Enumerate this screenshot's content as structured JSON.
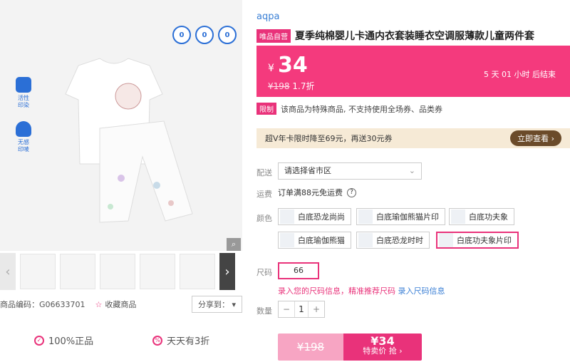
{
  "gallery": {
    "badges": [
      "0",
      "0",
      "0"
    ],
    "features": [
      "活性\n印染",
      "无感\n印唛"
    ],
    "zoom_icon": "magnifier-icon",
    "thumbs_count": 5
  },
  "meta": {
    "code_label": "商品编码：",
    "code_value": "G06633701",
    "fav_label": "收藏商品",
    "share_label": "分享到："
  },
  "guarantee": {
    "a": "100%正品",
    "b": "天天有3折"
  },
  "product": {
    "brand": "aqpa",
    "self_tag": "唯品自营",
    "title": "夏季纯棉婴儿卡通内衣套装睡衣空调服薄款儿童两件套",
    "currency": "¥",
    "price": "34",
    "orig_price": "¥198",
    "discount": "1.7折",
    "countdown": "5 天 01 小时 后结束"
  },
  "notice": {
    "tag": "限制",
    "text": "该商品为特殊商品, 不支持使用全场券、品类券"
  },
  "vip": {
    "text": "超V年卡限时降至69元，再送30元券",
    "btn": "立即查看 ›"
  },
  "delivery": {
    "label": "配送",
    "placeholder": "请选择省市区",
    "ship_label": "运费",
    "ship_text": "订单满88元免运费"
  },
  "colors": {
    "label": "颜色",
    "options": [
      "白底恐龙尚尚",
      "白底瑜伽熊猫片印",
      "白底功夫象",
      "白底瑜伽熊猫",
      "白底恐龙时时",
      "白底功夫象片印"
    ]
  },
  "size": {
    "label": "尺码",
    "value": "66",
    "hint_a": "录入您的尺码信息，精准推荐尺码",
    "hint_b": "录入尺码信息"
  },
  "qty": {
    "label": "数量",
    "minus": "−",
    "value": "1",
    "plus": "+"
  },
  "buy": {
    "orig": "¥198",
    "price": "¥34",
    "action": "特卖价 抢 ›"
  },
  "colors_theme": {
    "accent": "#e9327a",
    "price_bg": "#f43a7d",
    "link": "#3a7fd5"
  }
}
